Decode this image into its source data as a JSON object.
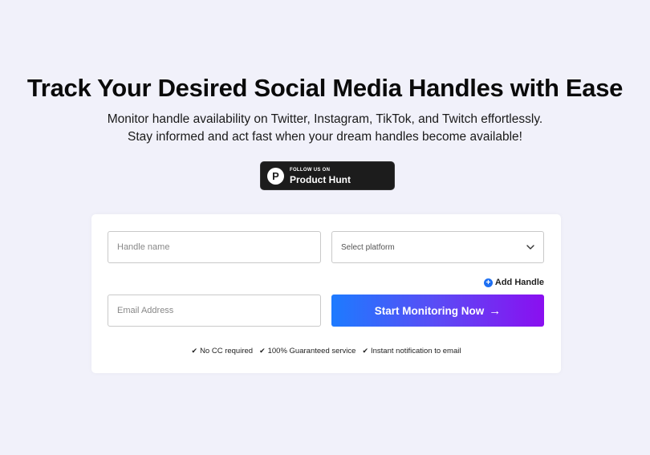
{
  "hero": {
    "title": "Track Your Desired Social Media Handles with Ease",
    "subtitle": "Monitor handle availability on Twitter, Instagram, TikTok, and Twitch effortlessly. Stay informed and act fast when your dream handles become available!"
  },
  "product_hunt": {
    "small_text": "FOLLOW US ON",
    "big_text": "Product Hunt",
    "logo_letter": "P"
  },
  "form": {
    "handle_placeholder": "Handle name",
    "handle_value": "",
    "platform_selected": "Select platform",
    "add_handle_label": "Add Handle",
    "email_placeholder": "Email Address",
    "email_value": "",
    "submit_label": "Start Monitoring Now",
    "features": [
      {
        "label": "No CC required"
      },
      {
        "label": "100% Guaranteed service"
      },
      {
        "label": "Instant notification to email"
      }
    ]
  },
  "colors": {
    "background": "#f1f1fa",
    "accent_blue": "#1d6ff2",
    "gradient_start": "#1d7bff",
    "gradient_end": "#8a0ff0"
  },
  "icons": {
    "arrow": "arrow-right-icon",
    "chevron": "chevron-down-icon",
    "plus": "plus-circle-icon",
    "check": "check-icon"
  }
}
